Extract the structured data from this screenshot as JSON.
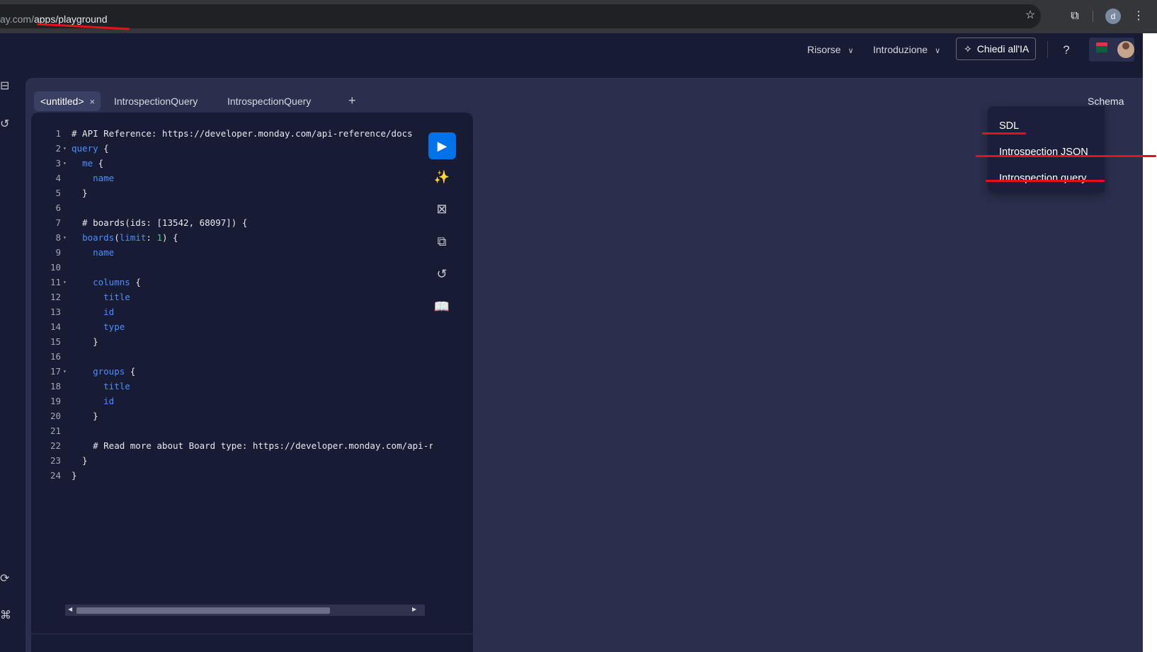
{
  "browser": {
    "url_prefix": "ay.com/",
    "url_path": "apps/playground",
    "icons": [
      "star-icon",
      "extensions-icon",
      "profile-icon",
      "kebab-menu-icon"
    ],
    "profile_initial": "d"
  },
  "header": {
    "nav": [
      {
        "label": "Risorse"
      },
      {
        "label": "Introduzione"
      }
    ],
    "ask_ai": "Chiedi all'IA",
    "help": "?"
  },
  "tabs": [
    {
      "label": "<untitled>",
      "active": true,
      "close": "×"
    },
    {
      "label": "IntrospectionQuery"
    },
    {
      "label": "IntrospectionQuery"
    }
  ],
  "add_tab": "+",
  "schema": {
    "label": "Schema",
    "menu": [
      "SDL",
      "Introspection JSON",
      "Introspection query"
    ]
  },
  "editor": {
    "lines": [
      "1",
      "2",
      "3",
      "4",
      "5",
      "6",
      "7",
      "8",
      "9",
      "10",
      "11",
      "12",
      "13",
      "14",
      "15",
      "16",
      "17",
      "18",
      "19",
      "20",
      "21",
      "22",
      "23",
      "24"
    ],
    "code": [
      [
        {
          "t": "cm",
          "v": "# API Reference: https://developer.monday.com/api-reference/docs"
        }
      ],
      [
        {
          "t": "kw",
          "v": "query"
        },
        {
          "t": "p",
          "v": " {"
        }
      ],
      [
        {
          "t": "p",
          "v": "  "
        },
        {
          "t": "fld",
          "v": "me"
        },
        {
          "t": "p",
          "v": " {"
        }
      ],
      [
        {
          "t": "p",
          "v": "    "
        },
        {
          "t": "fld",
          "v": "name"
        }
      ],
      [
        {
          "t": "p",
          "v": "  }"
        }
      ],
      [
        {
          "t": "p",
          "v": ""
        }
      ],
      [
        {
          "t": "cm",
          "v": "  # boards(ids: [13542, 68097]) {"
        }
      ],
      [
        {
          "t": "p",
          "v": "  "
        },
        {
          "t": "fld",
          "v": "boards"
        },
        {
          "t": "p",
          "v": "("
        },
        {
          "t": "fld",
          "v": "limit"
        },
        {
          "t": "p",
          "v": ": "
        },
        {
          "t": "num",
          "v": "1"
        },
        {
          "t": "p",
          "v": ") {"
        }
      ],
      [
        {
          "t": "p",
          "v": "    "
        },
        {
          "t": "fld",
          "v": "name"
        }
      ],
      [
        {
          "t": "p",
          "v": ""
        }
      ],
      [
        {
          "t": "p",
          "v": "    "
        },
        {
          "t": "fld",
          "v": "columns"
        },
        {
          "t": "p",
          "v": " {"
        }
      ],
      [
        {
          "t": "p",
          "v": "      "
        },
        {
          "t": "fld",
          "v": "title"
        }
      ],
      [
        {
          "t": "p",
          "v": "      "
        },
        {
          "t": "fld",
          "v": "id"
        }
      ],
      [
        {
          "t": "p",
          "v": "      "
        },
        {
          "t": "fld",
          "v": "type"
        }
      ],
      [
        {
          "t": "p",
          "v": "    }"
        }
      ],
      [
        {
          "t": "p",
          "v": ""
        }
      ],
      [
        {
          "t": "p",
          "v": "    "
        },
        {
          "t": "fld",
          "v": "groups"
        },
        {
          "t": "p",
          "v": " {"
        }
      ],
      [
        {
          "t": "p",
          "v": "      "
        },
        {
          "t": "fld",
          "v": "title"
        }
      ],
      [
        {
          "t": "p",
          "v": "      "
        },
        {
          "t": "fld",
          "v": "id"
        }
      ],
      [
        {
          "t": "p",
          "v": "    }"
        }
      ],
      [
        {
          "t": "p",
          "v": ""
        }
      ],
      [
        {
          "t": "cm",
          "v": "    # Read more about Board type: https://developer.monday.com/api-reference/reference/boards"
        }
      ],
      [
        {
          "t": "p",
          "v": "  }"
        }
      ],
      [
        {
          "t": "p",
          "v": "}"
        }
      ]
    ],
    "foldable_lines": [
      2,
      3,
      8,
      11,
      17
    ],
    "fold_marker": "▾"
  },
  "toolbar": {
    "run_icon": "play-icon",
    "icons": [
      "prettify-icon",
      "merge-fragments-icon",
      "copy-icon",
      "history-icon",
      "docs-icon"
    ]
  },
  "colors": {
    "background": "#181b34",
    "panel": "#292f4c",
    "accent": "#0073ea",
    "keyword": "#4e8dff",
    "number": "#33d391",
    "annotation": "#e8101a"
  }
}
